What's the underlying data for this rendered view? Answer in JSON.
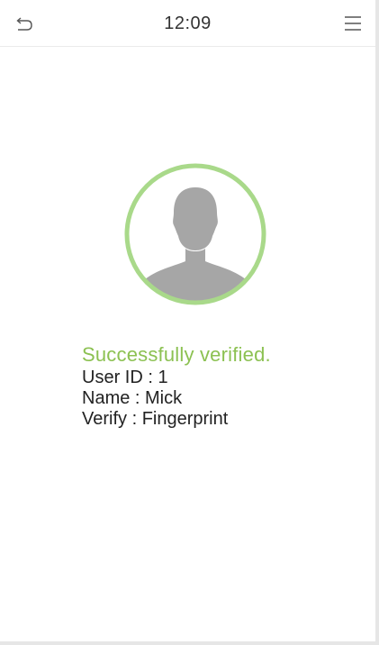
{
  "header": {
    "time": "12:09",
    "back_icon": "undo-arrow-icon",
    "menu_icon": "hamburger-menu-icon"
  },
  "result": {
    "status": "Successfully verified.",
    "user_id": "User ID : 1",
    "name": "Name : Mick",
    "verify": "Verify : Fingerprint"
  },
  "colors": {
    "accent_green": "#8cc152",
    "avatar_gray": "#a6a6a6",
    "text": "#222222"
  }
}
